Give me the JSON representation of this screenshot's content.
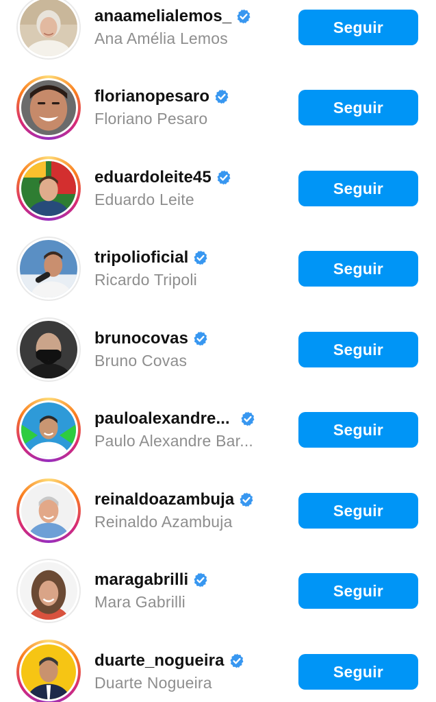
{
  "accent_color": "#0095f6",
  "verified_badge_color": "#3897f0",
  "follow_label": "Seguir",
  "users": [
    {
      "username": "anaamelialemos_",
      "fullname": "Ana Amélia Lemos",
      "verified": true,
      "story_ring": false,
      "avatar": "woman-white-hair"
    },
    {
      "username": "florianopesaro",
      "fullname": "Floriano Pesaro",
      "verified": true,
      "story_ring": true,
      "avatar": "man-smiling"
    },
    {
      "username": "eduardoleite45",
      "fullname": "Eduardo Leite",
      "verified": true,
      "story_ring": true,
      "avatar": "man-flag-background"
    },
    {
      "username": "tripolioficial",
      "fullname": "Ricardo Tripoli",
      "verified": true,
      "story_ring": false,
      "avatar": "man-microphone"
    },
    {
      "username": "brunocovas",
      "fullname": "Bruno Covas",
      "verified": true,
      "story_ring": false,
      "avatar": "man-black-mask"
    },
    {
      "username": "pauloalexandre...",
      "fullname": "Paulo Alexandre Bar...",
      "verified": true,
      "story_ring": true,
      "avatar": "man-green-background"
    },
    {
      "username": "reinaldoazambuja",
      "fullname": "Reinaldo Azambuja",
      "verified": true,
      "story_ring": true,
      "avatar": "man-white-hair"
    },
    {
      "username": "maragabrilli",
      "fullname": "Mara Gabrilli",
      "verified": true,
      "story_ring": false,
      "avatar": "woman-brown-hair"
    },
    {
      "username": "duarte_nogueira",
      "fullname": "Duarte Nogueira",
      "verified": true,
      "story_ring": true,
      "avatar": "man-yellow-background"
    }
  ]
}
